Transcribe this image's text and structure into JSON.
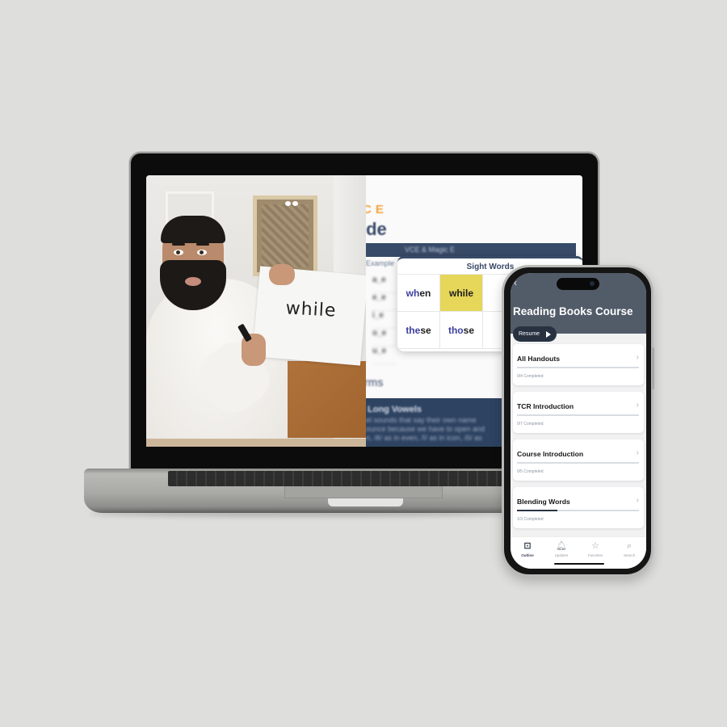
{
  "laptop": {
    "video": {
      "whiteboard_word": "while"
    },
    "reference_guide": {
      "kicker": "CE",
      "title": "ide",
      "table_bar": "VCE & Magic E",
      "column_header": "Example",
      "rows": [
        "a_e",
        "e_e",
        "i_e",
        "o_e",
        "u_e"
      ],
      "terms_heading": "rms",
      "long_vowels": {
        "title": "Long Vowels",
        "lines": [
          "el sounds that say their own name",
          "ounce because we have to open and",
          "n, /ē/ as in even, /ī/ as in icon, /ō/ as"
        ]
      }
    },
    "sight_words": {
      "title": "Sight Words",
      "words": [
        {
          "text": "when",
          "prefix": "wh",
          "rest": "en",
          "highlight": false
        },
        {
          "text": "while",
          "prefix": "",
          "rest": "while",
          "highlight": true
        },
        {
          "text": "",
          "prefix": "",
          "rest": "",
          "highlight": false
        },
        {
          "text": "these",
          "prefix": "the",
          "rest": "se",
          "highlight": false
        },
        {
          "text": "those",
          "prefix": "tho",
          "rest": "se",
          "highlight": false
        },
        {
          "text": "",
          "prefix": "",
          "rest": "",
          "highlight": false
        }
      ],
      "highlight_color": "#e6d65a",
      "digraph_color": "#3d3fa0"
    }
  },
  "phone": {
    "header": {
      "back_icon": "chevron-left",
      "title": "Reading Books Course",
      "resume_label": "Resume",
      "bg_color": "#525c69"
    },
    "sections": [
      {
        "title": "All Handouts",
        "completed": 0,
        "total": 4,
        "status": "0/4 Completed",
        "progress": 0.0
      },
      {
        "title": "TCR Introduction",
        "completed": 0,
        "total": 7,
        "status": "0/7 Completed",
        "progress": 0.0
      },
      {
        "title": "Course Introduction",
        "completed": 0,
        "total": 5,
        "status": "0/5 Completed",
        "progress": 0.0
      },
      {
        "title": "Blending Words",
        "completed": 1,
        "total": 3,
        "status": "1/3 Completed",
        "progress": 0.333
      }
    ],
    "tabbar": [
      {
        "label": "Outline",
        "icon": "book-open",
        "glyph": "⊡",
        "active": true
      },
      {
        "label": "Updates",
        "icon": "bell",
        "glyph": "🔔︎",
        "active": false
      },
      {
        "label": "Favorites",
        "icon": "star",
        "glyph": "☆",
        "active": false
      },
      {
        "label": "Search",
        "icon": "search",
        "glyph": "⌕",
        "active": false
      }
    ]
  }
}
